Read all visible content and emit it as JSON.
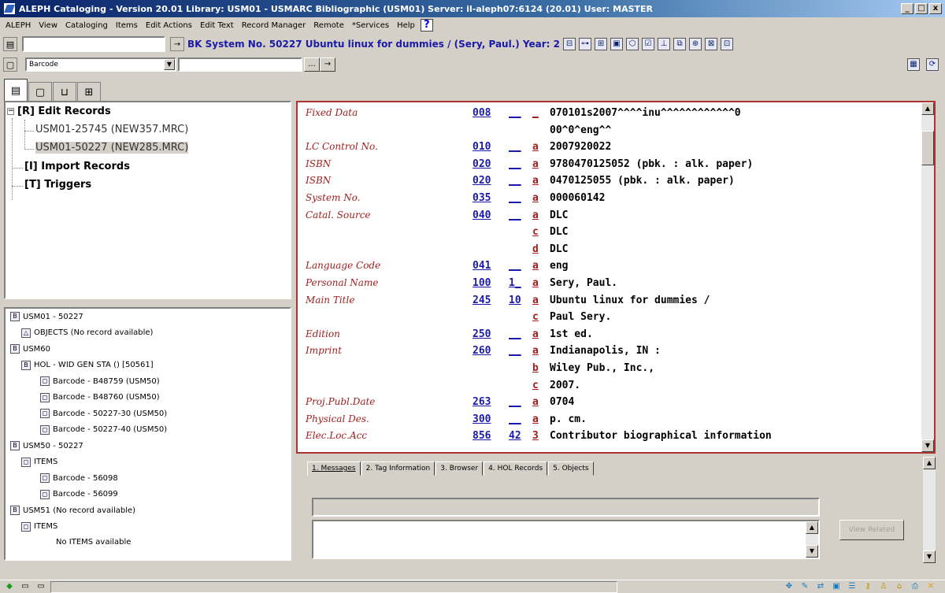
{
  "window": {
    "title": "ALEPH Cataloging - Version 20.01  Library:  USM01 - USMARC Bibliographic (USM01)  Server:  il-aleph07:6124 (20.01)  User:  MASTER",
    "min": "_",
    "max": "□",
    "close": "x"
  },
  "menu": [
    "ALEPH",
    "View",
    "Cataloging",
    "Items",
    "Edit Actions",
    "Edit Text",
    "Record Manager",
    "Remote",
    "*Services",
    "Help"
  ],
  "help_icon": "?",
  "toolbar": {
    "record_title": "BK System No. 50227 Ubuntu linux for dummies / (Sery, Paul.) Year: 2",
    "goto_arrow": "→",
    "search_value": ""
  },
  "search_bar": {
    "selected_index": "Barcode",
    "query": "",
    "more_btn": "...",
    "go_btn": "→"
  },
  "tree": {
    "edit_records": "[R] Edit Records",
    "rec1": "USM01-25745 (NEW357.MRC)",
    "rec2": "USM01-50227 (NEW285.MRC)",
    "import_records": "[I] Import Records",
    "triggers": "[T] Triggers"
  },
  "nav_tree": [
    {
      "text": "USM01 - 50227",
      "icon": "B"
    },
    {
      "text": "OBJECTS (No record available)",
      "icon": "△"
    },
    {
      "text": "USM60",
      "icon": "B"
    },
    {
      "text": "HOL - WID GEN STA () [50561]",
      "icon": "B"
    },
    {
      "text": "Barcode - B48759 (USM50)",
      "icon": "◻"
    },
    {
      "text": "Barcode - B48760 (USM50)",
      "icon": "◻"
    },
    {
      "text": "Barcode - 50227-30 (USM50)",
      "icon": "◻"
    },
    {
      "text": "Barcode - 50227-40 (USM50)",
      "icon": "◻"
    },
    {
      "text": "USM50 - 50227",
      "icon": "B"
    },
    {
      "text": "ITEMS",
      "icon": "◻"
    },
    {
      "text": "Barcode - 56098",
      "icon": "◻"
    },
    {
      "text": "Barcode - 56099",
      "icon": "◻"
    },
    {
      "text": "USM51 (No record available)",
      "icon": "B"
    },
    {
      "text": "ITEMS",
      "icon": "◻"
    },
    {
      "text": "No ITEMS available",
      "icon": ""
    }
  ],
  "record": [
    {
      "label": "Fixed Data",
      "tag": "008",
      "ind": "__",
      "sub": "_",
      "value": "070101s2007^^^^inu^^^^^^^^^^^^0"
    },
    {
      "label": "",
      "tag": "",
      "ind": "",
      "sub": "",
      "value": "00^0^eng^^"
    },
    {
      "label": "LC Control No.",
      "tag": "010",
      "ind": "__",
      "sub": "a",
      "value": "2007920022"
    },
    {
      "label": "ISBN",
      "tag": "020",
      "ind": "__",
      "sub": "a",
      "value": "9780470125052 (pbk. : alk. paper)"
    },
    {
      "label": "ISBN",
      "tag": "020",
      "ind": "__",
      "sub": "a",
      "value": "0470125055 (pbk. : alk. paper)"
    },
    {
      "label": "System No.",
      "tag": "035",
      "ind": "__",
      "sub": "a",
      "value": "000060142"
    },
    {
      "label": "Catal. Source",
      "tag": "040",
      "ind": "__",
      "sub": "a",
      "value": "DLC"
    },
    {
      "label": "",
      "tag": "",
      "ind": "",
      "sub": "c",
      "value": "DLC"
    },
    {
      "label": "",
      "tag": "",
      "ind": "",
      "sub": "d",
      "value": "DLC"
    },
    {
      "label": "Language Code",
      "tag": "041",
      "ind": "__",
      "sub": "a",
      "value": "eng"
    },
    {
      "label": "Personal Name",
      "tag": "100",
      "ind": "1_",
      "sub": "a",
      "value": "Sery, Paul."
    },
    {
      "label": "Main Title",
      "tag": "245",
      "ind": "10",
      "sub": "a",
      "value": "Ubuntu linux for dummies /"
    },
    {
      "label": "",
      "tag": "",
      "ind": "",
      "sub": "c",
      "value": "Paul Sery."
    },
    {
      "label": "Edition",
      "tag": "250",
      "ind": "__",
      "sub": "a",
      "value": "1st ed."
    },
    {
      "label": "Imprint",
      "tag": "260",
      "ind": "__",
      "sub": "a",
      "value": "Indianapolis, IN :"
    },
    {
      "label": "",
      "tag": "",
      "ind": "",
      "sub": "b",
      "value": "Wiley Pub., Inc.,"
    },
    {
      "label": "",
      "tag": "",
      "ind": "",
      "sub": "c",
      "value": "2007."
    },
    {
      "label": "Proj.Publ.Date",
      "tag": "263",
      "ind": "__",
      "sub": "a",
      "value": "0704"
    },
    {
      "label": "Physical Des.",
      "tag": "300",
      "ind": "__",
      "sub": "a",
      "value": "p. cm."
    },
    {
      "label": "Elec.Loc.Acc",
      "tag": "856",
      "ind": "42",
      "sub": "3",
      "value": "Contributor biographical information"
    }
  ],
  "bottom": {
    "tabs": [
      "1. Messages",
      "2. Tag Information",
      "3. Browser",
      "4. HOL Records",
      "5. Objects"
    ],
    "view_related": "View Related"
  },
  "colors": {
    "label": "#a02020",
    "tag": "#1a1aa8",
    "record_border": "#a33"
  }
}
